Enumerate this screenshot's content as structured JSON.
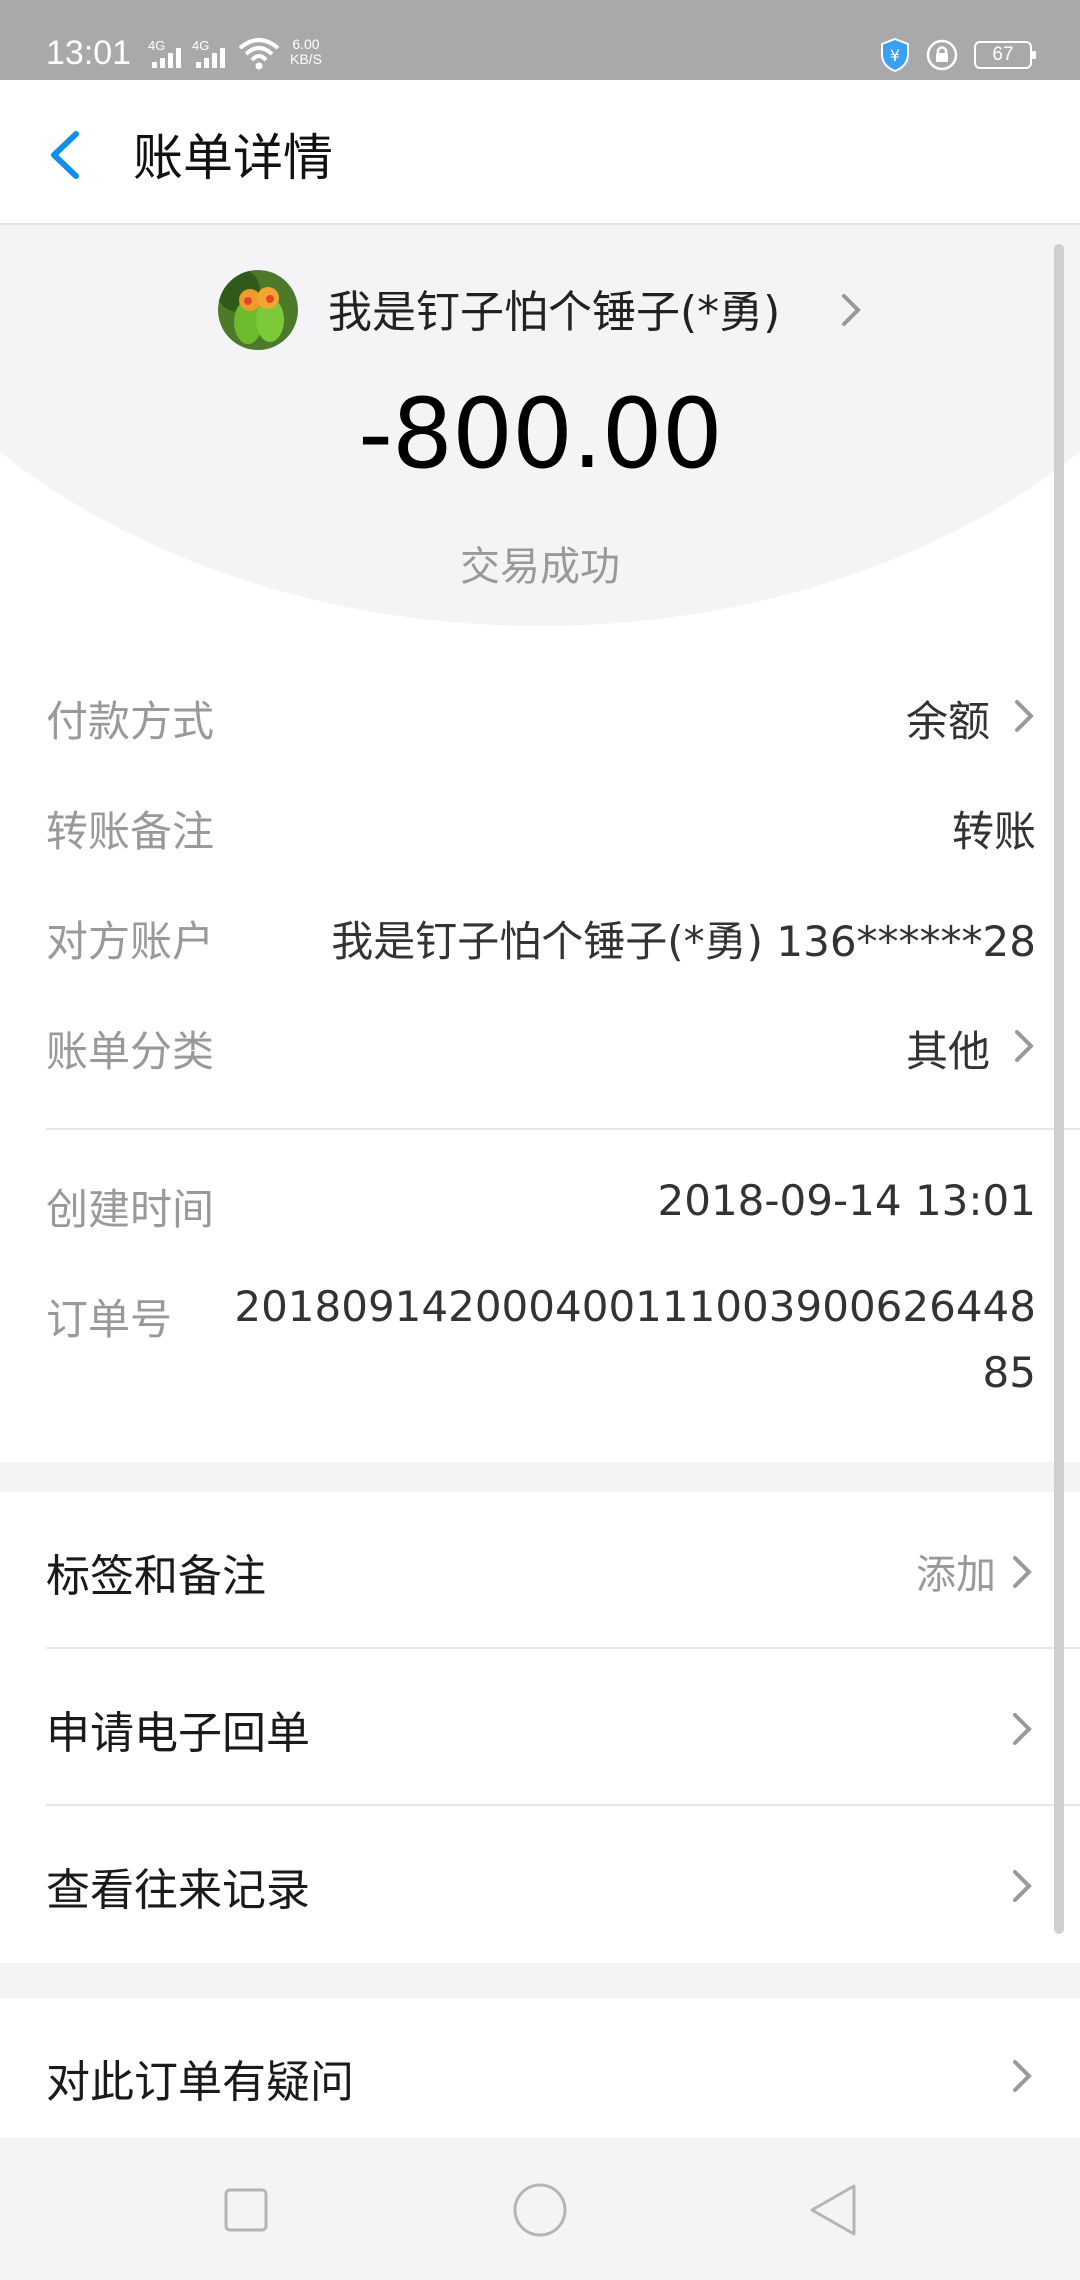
{
  "status_bar": {
    "time": "13:01",
    "network_1": "4G",
    "network_2": "4G",
    "speed_value": "6.00",
    "speed_unit": "KB/S",
    "battery": "67"
  },
  "header": {
    "title": "账单详情"
  },
  "transaction": {
    "payee_name": "我是钉子怕个锤子(*勇)",
    "amount": "-800.00",
    "status": "交易成功"
  },
  "details": {
    "payment_method_label": "付款方式",
    "payment_method_value": "余额",
    "transfer_note_label": "转账备注",
    "transfer_note_value": "转账",
    "counterparty_label": "对方账户",
    "counterparty_value": "我是钉子怕个锤子(*勇) 136******28",
    "category_label": "账单分类",
    "category_value": "其他",
    "created_time_label": "创建时间",
    "created_time_value": "2018-09-14 13:01",
    "order_no_label": "订单号",
    "order_no_line1": "20180914200040011100390062644​8",
    "order_no_line2": "85"
  },
  "actions": {
    "tags_notes_label": "标签和备注",
    "tags_notes_hint": "添加",
    "e_receipt_label": "申请电子回单",
    "history_label": "查看往来记录",
    "question_label": "对此订单有疑问"
  },
  "colors": {
    "accent": "#108ee9",
    "label_gray": "#999999",
    "background": "#f4f4f6"
  }
}
